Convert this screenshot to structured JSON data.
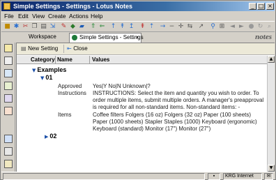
{
  "window": {
    "title": "Simple Settings - Settings - Lotus Notes",
    "controls": [
      "_",
      "□",
      "×"
    ]
  },
  "menu": [
    "File",
    "Edit",
    "View",
    "Create",
    "Actions",
    "Help"
  ],
  "tabs": {
    "workspace": "Workspace",
    "active": "Simple Settings - Settings",
    "close": "×"
  },
  "brand": "notes",
  "actions": {
    "new_setting": "New Setting",
    "close": "Close"
  },
  "columns": {
    "category": "Category",
    "name": "Name",
    "values": "Values"
  },
  "categories": {
    "examples": "Examples",
    "c01": "01",
    "c02": "02"
  },
  "fields": [
    {
      "name": "Approved",
      "value": "Yes|Y No|N Unknown|?"
    },
    {
      "name": "Instructions",
      "value": "INSTRUCTIONS:  Select the item and quantity you wish to order. To order multiple items, submit multiple orders.   A manager's preapproval is required for all non-standard items.   Non-standard items:  -"
    },
    {
      "name": "Items",
      "value": "Coffee filters  Folgers (16 oz)  Folgers (32 oz)  Paper (100 sheets)  Paper (1000 sheets)  Stapler  Staples (1000)  Keyboard (ergonomic)  Keyboard (standard)  Monitor (17\")  Monitor (27\")"
    }
  ],
  "status": {
    "connection": "KRG Internet"
  },
  "colors": {
    "title_start": "#0a246a",
    "title_end": "#a6caf0",
    "twisty": "#1b4fa8"
  }
}
